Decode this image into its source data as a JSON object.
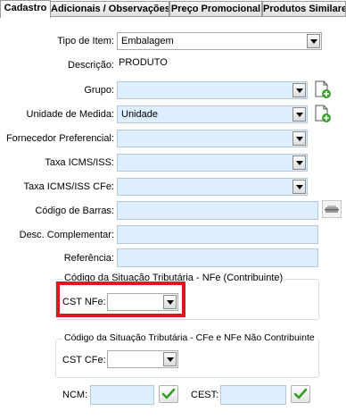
{
  "tabs": [
    {
      "label": "Cadastro",
      "active": true
    },
    {
      "label": "Adicionais / Observações",
      "active": false
    },
    {
      "label": "Preço Promocional",
      "active": false
    },
    {
      "label": "Produtos Similares",
      "active": false
    }
  ],
  "form": {
    "tipo_item": {
      "label": "Tipo de Item:",
      "value": "Embalagem"
    },
    "descricao": {
      "label": "Descrição:",
      "value": "PRODUTO"
    },
    "grupo": {
      "label": "Grupo:",
      "value": ""
    },
    "unidade_medida": {
      "label": "Unidade de Medida:",
      "value": "Unidade"
    },
    "fornecedor": {
      "label": "Fornecedor Preferencial:",
      "value": ""
    },
    "taxa_icms": {
      "label": "Taxa ICMS/ISS:",
      "value": ""
    },
    "taxa_icms_cfe": {
      "label": "Taxa ICMS/ISS CFe:",
      "value": ""
    },
    "codigo_barras": {
      "label": "Código de Barras:",
      "value": ""
    },
    "desc_complementar": {
      "label": "Desc. Complementar:",
      "value": ""
    },
    "referencia": {
      "label": "Referência:",
      "value": ""
    }
  },
  "cst_nfe_group": {
    "title": "Código da Situação Tributária - NFe (Contribuinte)",
    "label": "CST NFe:",
    "value": ""
  },
  "cst_cfe_group": {
    "title": "Código da Situação Tributária - CFe e NFe Não Contribuinte",
    "label": "CST CFe:",
    "value": ""
  },
  "ncm": {
    "label": "NCM:",
    "value": ""
  },
  "cest": {
    "label": "CEST:",
    "value": ""
  },
  "icons": {
    "new_record": "new-document-icon",
    "barcode": "barcode-scanner-icon",
    "confirm": "checkmark-icon",
    "dropdown": "chevron-down-icon"
  },
  "colors": {
    "field_background": "#ddeeff",
    "highlight": "#d71920",
    "check": "#3a9a2a"
  }
}
